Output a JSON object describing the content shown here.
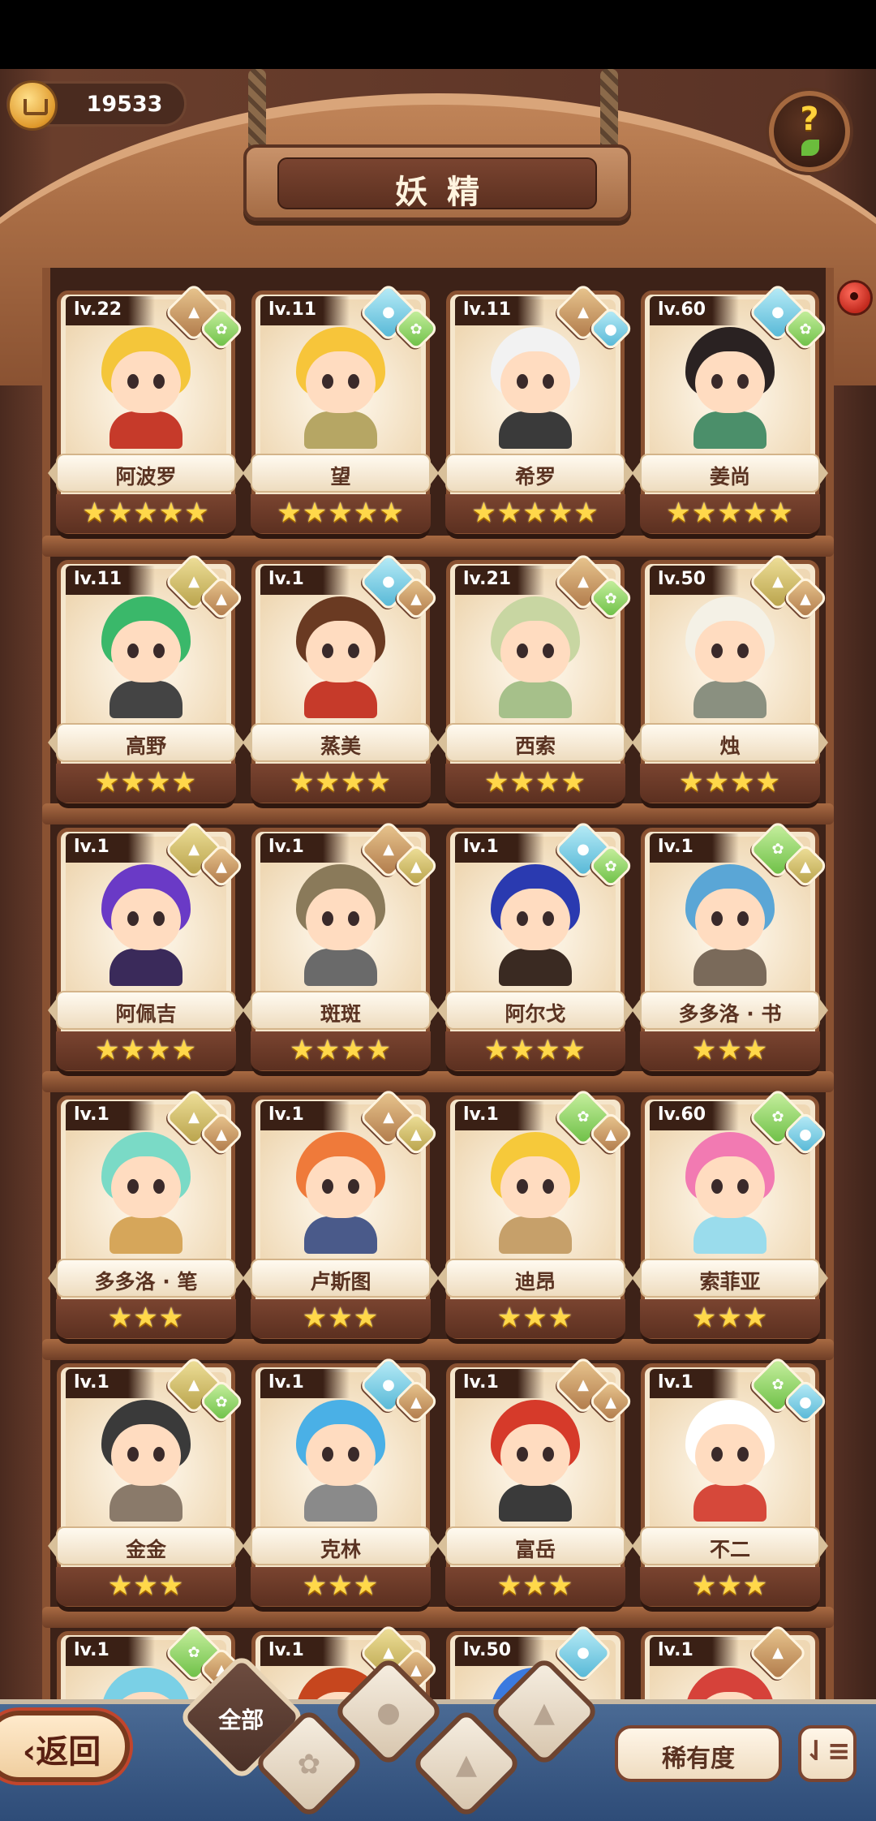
{
  "currency": {
    "value": "19533",
    "icon": "crown-coin-icon"
  },
  "header": {
    "title": "妖精"
  },
  "help": {
    "label": "?"
  },
  "spirits": [
    {
      "level": "lv.22",
      "name": "阿波罗",
      "stars": "★★★★★",
      "elements": [
        "earth",
        "wood"
      ],
      "hair": "#f4c63a",
      "outfit": "#c63a2a"
    },
    {
      "level": "lv.11",
      "name": "望",
      "stars": "★★★★★",
      "elements": [
        "water",
        "wood"
      ],
      "hair": "#f7c53a",
      "outfit": "#b6a664"
    },
    {
      "level": "lv.11",
      "name": "希罗",
      "stars": "★★★★★",
      "elements": [
        "earth",
        "water"
      ],
      "hair": "#f2f2f2",
      "outfit": "#3a3a3a"
    },
    {
      "level": "lv.60",
      "name": "姜尚",
      "stars": "★★★★★",
      "elements": [
        "water",
        "wood"
      ],
      "hair": "#2a2222",
      "outfit": "#4b8f6a"
    },
    {
      "level": "lv.11",
      "name": "高野",
      "stars": "★★★★",
      "elements": [
        "sand",
        "earth"
      ],
      "hair": "#3ab86a",
      "outfit": "#444444"
    },
    {
      "level": "lv.1",
      "name": "蒸美",
      "stars": "★★★★",
      "elements": [
        "water",
        "earth"
      ],
      "hair": "#6a3a22",
      "outfit": "#c63a2a"
    },
    {
      "level": "lv.21",
      "name": "西索",
      "stars": "★★★★",
      "elements": [
        "earth",
        "wood"
      ],
      "hair": "#c8d6a2",
      "outfit": "#a6c08a"
    },
    {
      "level": "lv.50",
      "name": "烛",
      "stars": "★★★★",
      "elements": [
        "sand",
        "earth"
      ],
      "hair": "#f4f1e6",
      "outfit": "#8a9080"
    },
    {
      "level": "lv.1",
      "name": "阿佩吉",
      "stars": "★★★★",
      "elements": [
        "sand",
        "earth"
      ],
      "hair": "#6a3ac6",
      "outfit": "#3a2a5a"
    },
    {
      "level": "lv.1",
      "name": "斑斑",
      "stars": "★★★★",
      "elements": [
        "earth",
        "sand"
      ],
      "hair": "#8a7a5a",
      "outfit": "#6a6a6a"
    },
    {
      "level": "lv.1",
      "name": "阿尔戈",
      "stars": "★★★★",
      "elements": [
        "water",
        "wood"
      ],
      "hair": "#2a3ab0",
      "outfit": "#3a2a22"
    },
    {
      "level": "lv.1",
      "name": "多多洛 · 书",
      "stars": "★★★",
      "elements": [
        "wood",
        "sand"
      ],
      "hair": "#5aa6d6",
      "outfit": "#7a6a5a"
    },
    {
      "level": "lv.1",
      "name": "多多洛 · 笔",
      "stars": "★★★",
      "elements": [
        "sand",
        "earth"
      ],
      "hair": "#7adac6",
      "outfit": "#d6a65a"
    },
    {
      "level": "lv.1",
      "name": "卢斯图",
      "stars": "★★★",
      "elements": [
        "earth",
        "sand"
      ],
      "hair": "#ef7a3a",
      "outfit": "#4a5a8a"
    },
    {
      "level": "lv.1",
      "name": "迪昂",
      "stars": "★★★",
      "elements": [
        "wood",
        "earth"
      ],
      "hair": "#f6c93a",
      "outfit": "#c6a06a"
    },
    {
      "level": "lv.60",
      "name": "索菲亚",
      "stars": "★★★",
      "elements": [
        "wood",
        "water"
      ],
      "hair": "#f27ab2",
      "outfit": "#9adcec"
    },
    {
      "level": "lv.1",
      "name": "金金",
      "stars": "★★★",
      "elements": [
        "sand",
        "wood"
      ],
      "hair": "#3a3a3a",
      "outfit": "#8a7a6a"
    },
    {
      "level": "lv.1",
      "name": "克林",
      "stars": "★★★",
      "elements": [
        "water",
        "earth"
      ],
      "hair": "#4ab0e6",
      "outfit": "#8a8a8a"
    },
    {
      "level": "lv.1",
      "name": "富岳",
      "stars": "★★★",
      "elements": [
        "earth",
        "earth"
      ],
      "hair": "#d63a2a",
      "outfit": "#3a3a3a"
    },
    {
      "level": "lv.1",
      "name": "不二",
      "stars": "★★★",
      "elements": [
        "wood",
        "water"
      ],
      "hair": "#ffffff",
      "outfit": "#d6483a"
    },
    {
      "level": "lv.1",
      "name": "",
      "stars": "",
      "elements": [
        "wood",
        "earth"
      ],
      "hair": "#7ad0e6",
      "outfit": "#7ad0e6"
    },
    {
      "level": "lv.1",
      "name": "",
      "stars": "",
      "elements": [
        "sand",
        "earth"
      ],
      "hair": "#c6461e",
      "outfit": "#c6461e"
    },
    {
      "level": "lv.50",
      "name": "",
      "stars": "",
      "elements": [
        "water"
      ],
      "hair": "#3a7ae0",
      "outfit": "#3a7ae0"
    },
    {
      "level": "lv.1",
      "name": "",
      "stars": "",
      "elements": [
        "earth"
      ],
      "hair": "#d6423a",
      "outfit": "#d6423a"
    }
  ],
  "bottom": {
    "back_label": "返回",
    "filters": [
      {
        "label": "全部",
        "icon": "all-filter",
        "active": true
      },
      {
        "label": "",
        "icon": "wood-sprout-icon"
      },
      {
        "label": "",
        "icon": "water-drop-icon"
      },
      {
        "label": "",
        "icon": "sand-mountain-icon"
      },
      {
        "label": "",
        "icon": "earth-mountain-icon"
      }
    ],
    "rarity_label": "稀有度",
    "sort_label": "⇃≡"
  },
  "colors": {
    "wood_dark": "#3d2218",
    "wood_mid": "#8a5232",
    "parchment": "#f5e6cc",
    "gold": "#ffd84a",
    "bottom_blue": "#2e4c78"
  }
}
